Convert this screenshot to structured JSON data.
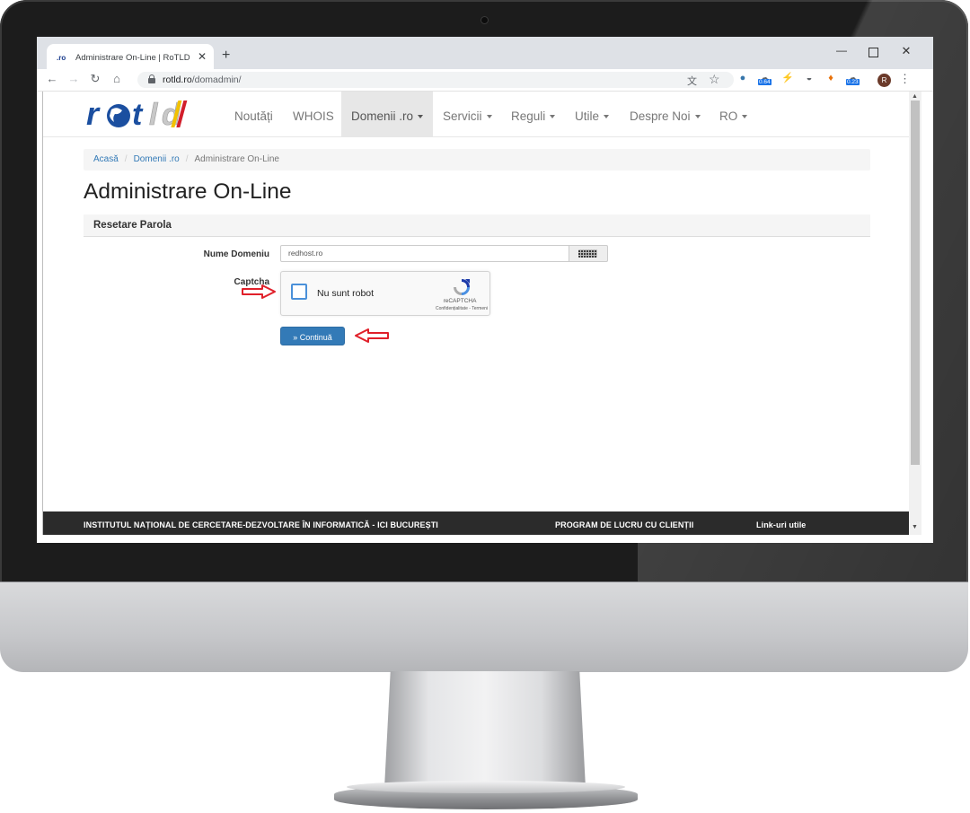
{
  "browser": {
    "tab_favicon": ".ro",
    "tab_title": "Administrare On-Line | RoTLD - R",
    "url_host": "rotld.ro",
    "url_path": "/domadmin/",
    "extension_badges": [
      "0.64",
      "0.23"
    ],
    "avatar_initial": "R"
  },
  "site": {
    "logo_text": "rotld",
    "nav": [
      {
        "label": "Noutăți",
        "dropdown": false
      },
      {
        "label": "WHOIS",
        "dropdown": false
      },
      {
        "label": "Domenii .ro",
        "dropdown": true,
        "active": true
      },
      {
        "label": "Servicii",
        "dropdown": true
      },
      {
        "label": "Reguli",
        "dropdown": true
      },
      {
        "label": "Utile",
        "dropdown": true
      },
      {
        "label": "Despre Noi",
        "dropdown": true
      },
      {
        "label": "RO",
        "dropdown": true
      }
    ]
  },
  "breadcrumb": [
    "Acasă",
    "Domenii .ro",
    "Administrare On-Line"
  ],
  "page_title": "Administrare On-Line",
  "panel_title": "Resetare Parola",
  "form": {
    "domain_label": "Nume Domeniu",
    "domain_value": "redhost.ro",
    "captcha_label": "Captcha",
    "recaptcha": {
      "checkbox_label": "Nu sunt robot",
      "brand": "reCAPTCHA",
      "terms": "Confidențialitate - Termeni"
    },
    "continue_label": "» Continuă"
  },
  "footer": {
    "col1": "INSTITUTUL NAȚIONAL DE CERCETARE-DEZVOLTARE ÎN INFORMATICĂ - ICI BUCUREȘTI",
    "col2": "PROGRAM DE LUCRU CU CLIENȚII",
    "col3": "Link-uri utile"
  },
  "colors": {
    "link_blue": "#337ab7",
    "annotation_red": "#e0202a",
    "footer_bg": "#2b2b2b"
  }
}
